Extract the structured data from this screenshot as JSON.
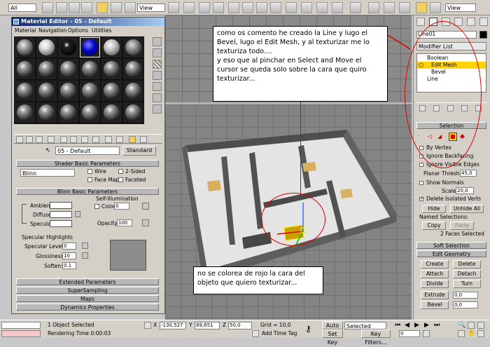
{
  "toolbar": {
    "selection_filter": "All",
    "view_dropdown_1": "View",
    "view_dropdown_2": "View"
  },
  "material_editor": {
    "title": "Material Editor - 05 - Default",
    "menu": [
      "Material",
      "Navigation",
      "Options",
      "Utilities"
    ],
    "material_name": "05 - Default",
    "type_button": "Standard",
    "shader_basic_title": "Shader Basic Parameters",
    "shader_type": "Blinn",
    "checkbox_wire": "Wire",
    "checkbox_2sided": "2-Sided",
    "checkbox_face_map": "Face Map",
    "checkbox_faceted": "Faceted",
    "blinn_basic_title": "Blinn Basic Parameters",
    "self_illumination_label": "Self-Illumination",
    "color_label": "Color",
    "color_value": "0",
    "ambient_label": "Ambient:",
    "diffuse_label": "Diffuse:",
    "specular_label": "Specular:",
    "opacity_label": "Opacity:",
    "opacity_value": "100",
    "specular_highlights_label": "Specular Highlights",
    "specular_level_label": "Specular Level:",
    "specular_level_value": "0",
    "glossiness_label": "Glossiness:",
    "glossiness_value": "10",
    "soften_label": "Soften:",
    "soften_value": "0.1",
    "rollouts": [
      "Extended Parameters",
      "SuperSampling",
      "Maps",
      "Dynamics Properties"
    ]
  },
  "annotations": {
    "top_note": "como os comento he creado la Line y lugo el Bevel, lugo el Edit Mesh, y al texturizar me lo texturiza todo....\ny eso que al pinchar en Select and Move el cursor se queda solo sobre la cara que quiro texturizar...",
    "bottom_note": "no se colorea de rojo la cara del objeto que quiero texturizar..."
  },
  "command_panel": {
    "object_name": "Line01",
    "modifier_list_label": "Modifier List",
    "stack": [
      "Boolean",
      "Edit Mesh",
      "Bevel",
      "Line"
    ],
    "selection_title": "Selection",
    "by_vertex": "By Vertex",
    "ignore_backfacing": "Ignore Backfacing",
    "ignore_visible_edges": "Ignore Visible Edges",
    "planar_thresh_label": "Planar Thresh",
    "planar_thresh_value": "45,0",
    "show_normals": "Show Normals",
    "scale_label": "Scale:",
    "scale_value": "20,0",
    "delete_isolated_verts": "Delete Isolated Verts",
    "hide_button": "Hide",
    "unhide_all_button": "Unhide All",
    "named_selections_label": "Named Selections:",
    "copy_button": "Copy",
    "paste_button": "Paste",
    "faces_selected": "2 Faces Selected",
    "soft_selection_title": "Soft Selection",
    "edit_geometry_title": "Edit Geometry",
    "create_button": "Create",
    "delete_button": "Delete",
    "attach_button": "Attach",
    "detach_button": "Detach",
    "divide_button": "Divide",
    "turn_button": "Turn",
    "extrude_button": "Extrude",
    "extrude_value": "0,0",
    "bevel_button": "Bevel",
    "bevel_value": "0,0"
  },
  "status_bar": {
    "objects_selected": "1 Object Selected",
    "rendering_time": "Rendering Time  0:00:03",
    "x_label": "X",
    "x_value": "-130,527",
    "y_label": "Y",
    "y_value": "89,651",
    "z_label": "Z",
    "z_value": "50,0",
    "grid": "Grid = 10,0",
    "add_time_tag": "Add Time Tag",
    "auto_key": "Auto Key",
    "set_key": "Set Key",
    "key_mode": "Selected",
    "key_filters": "Key Filters...",
    "frame": "0"
  },
  "colors": {
    "annotation_red": "#e00000",
    "active_modifier": "#ffd400",
    "selected_material": "#0000c8"
  }
}
